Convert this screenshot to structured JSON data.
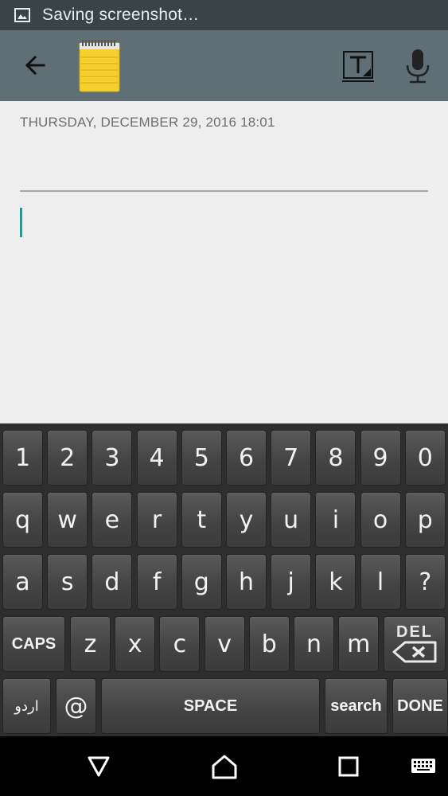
{
  "status_bar": {
    "text": "Saving screenshot…",
    "icon": "image-icon"
  },
  "toolbar": {
    "back_icon": "back-arrow-icon",
    "app_icon": "notepad-icon",
    "format_icon": "text-format-icon",
    "mic_icon": "microphone-icon",
    "colors": {
      "bar": "#5f6f75",
      "notepad": "#f6d23a"
    }
  },
  "note": {
    "date": "THURSDAY, DECEMBER 29, 2016 18:01",
    "title": "",
    "body": "",
    "cursor_color": "#1d9c9a"
  },
  "keyboard": {
    "row1": [
      "1",
      "2",
      "3",
      "4",
      "5",
      "6",
      "7",
      "8",
      "9",
      "0"
    ],
    "row2": [
      "q",
      "w",
      "e",
      "r",
      "t",
      "y",
      "u",
      "i",
      "o",
      "p"
    ],
    "row3": [
      "a",
      "s",
      "d",
      "f",
      "g",
      "h",
      "j",
      "k",
      "l",
      "?"
    ],
    "row4": {
      "caps": "CAPS",
      "letters": [
        "z",
        "x",
        "c",
        "v",
        "b",
        "n",
        "m"
      ],
      "del": "DEL"
    },
    "row5": {
      "lang": "اردو",
      "at": "@",
      "space": "SPACE",
      "search": "search",
      "done": "DONE"
    }
  },
  "nav_bar": {
    "back_icon": "nav-back-icon",
    "home_icon": "nav-home-icon",
    "recents_icon": "nav-recents-icon",
    "keyboard_icon": "keyboard-switch-icon"
  }
}
